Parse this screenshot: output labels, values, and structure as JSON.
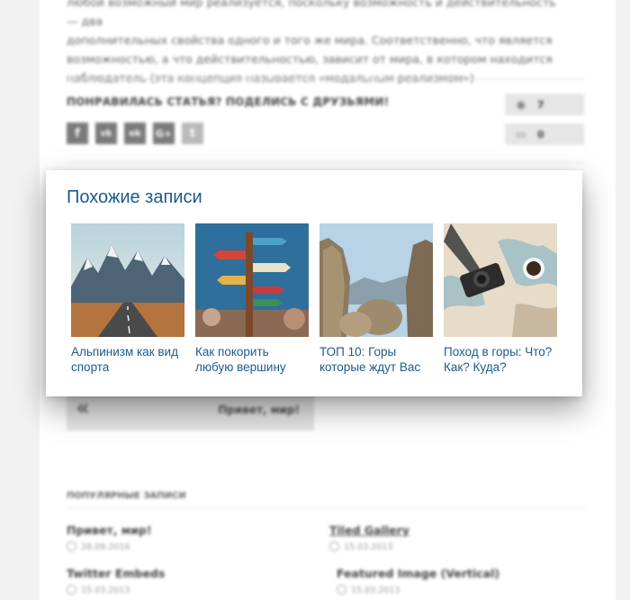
{
  "article": {
    "intro_lines": [
      "любой возможный мир реализуется, поскольку возможность и действительность — два",
      "дополнительных свойства одного и того же мира. Соответственно, что является",
      "возможностью, а что действительностью, зависит от мира, в котором находится",
      "наблюдатель (эта концепция называется «модальным реализмом»)"
    ]
  },
  "share": {
    "title": "ПОНРАВИЛАСЬ СТАТЬЯ? ПОДЕЛИСЬ С ДРУЗЬЯМИ!",
    "buttons": [
      {
        "label": "f",
        "icon": "facebook-icon"
      },
      {
        "label": "vk",
        "icon": "vk-icon"
      },
      {
        "label": "ok",
        "icon": "odnoklassniki-icon"
      },
      {
        "label": "G+",
        "icon": "google-plus-icon"
      },
      {
        "label": "t",
        "icon": "twitter-icon"
      }
    ],
    "views": "7",
    "comments": "0"
  },
  "related": {
    "title": "Похожие записи",
    "items": [
      {
        "label": "Альпинизм как вид спорта"
      },
      {
        "label": "Как покорить любую вершину"
      },
      {
        "label": "ТОП 10: Горы которые ждут Вас"
      },
      {
        "label": "Поход в горы: Что? Как? Куда?"
      }
    ]
  },
  "nav": {
    "prev_label": "Привет, мир!"
  },
  "popular": {
    "title": "ПОПУЛЯРНЫЕ ЗАПИСИ",
    "items": [
      {
        "title": "Привет, мир!",
        "date": "28.09.2016"
      },
      {
        "title": "Tiled Gallery",
        "date": "15.03.2013"
      },
      {
        "title": "Twitter Embeds",
        "date": "15.03.2013"
      },
      {
        "title": "Featured Image (Vertical)",
        "date": "15.03.2013"
      }
    ]
  },
  "colors": {
    "accent": "#1b5a8c"
  }
}
